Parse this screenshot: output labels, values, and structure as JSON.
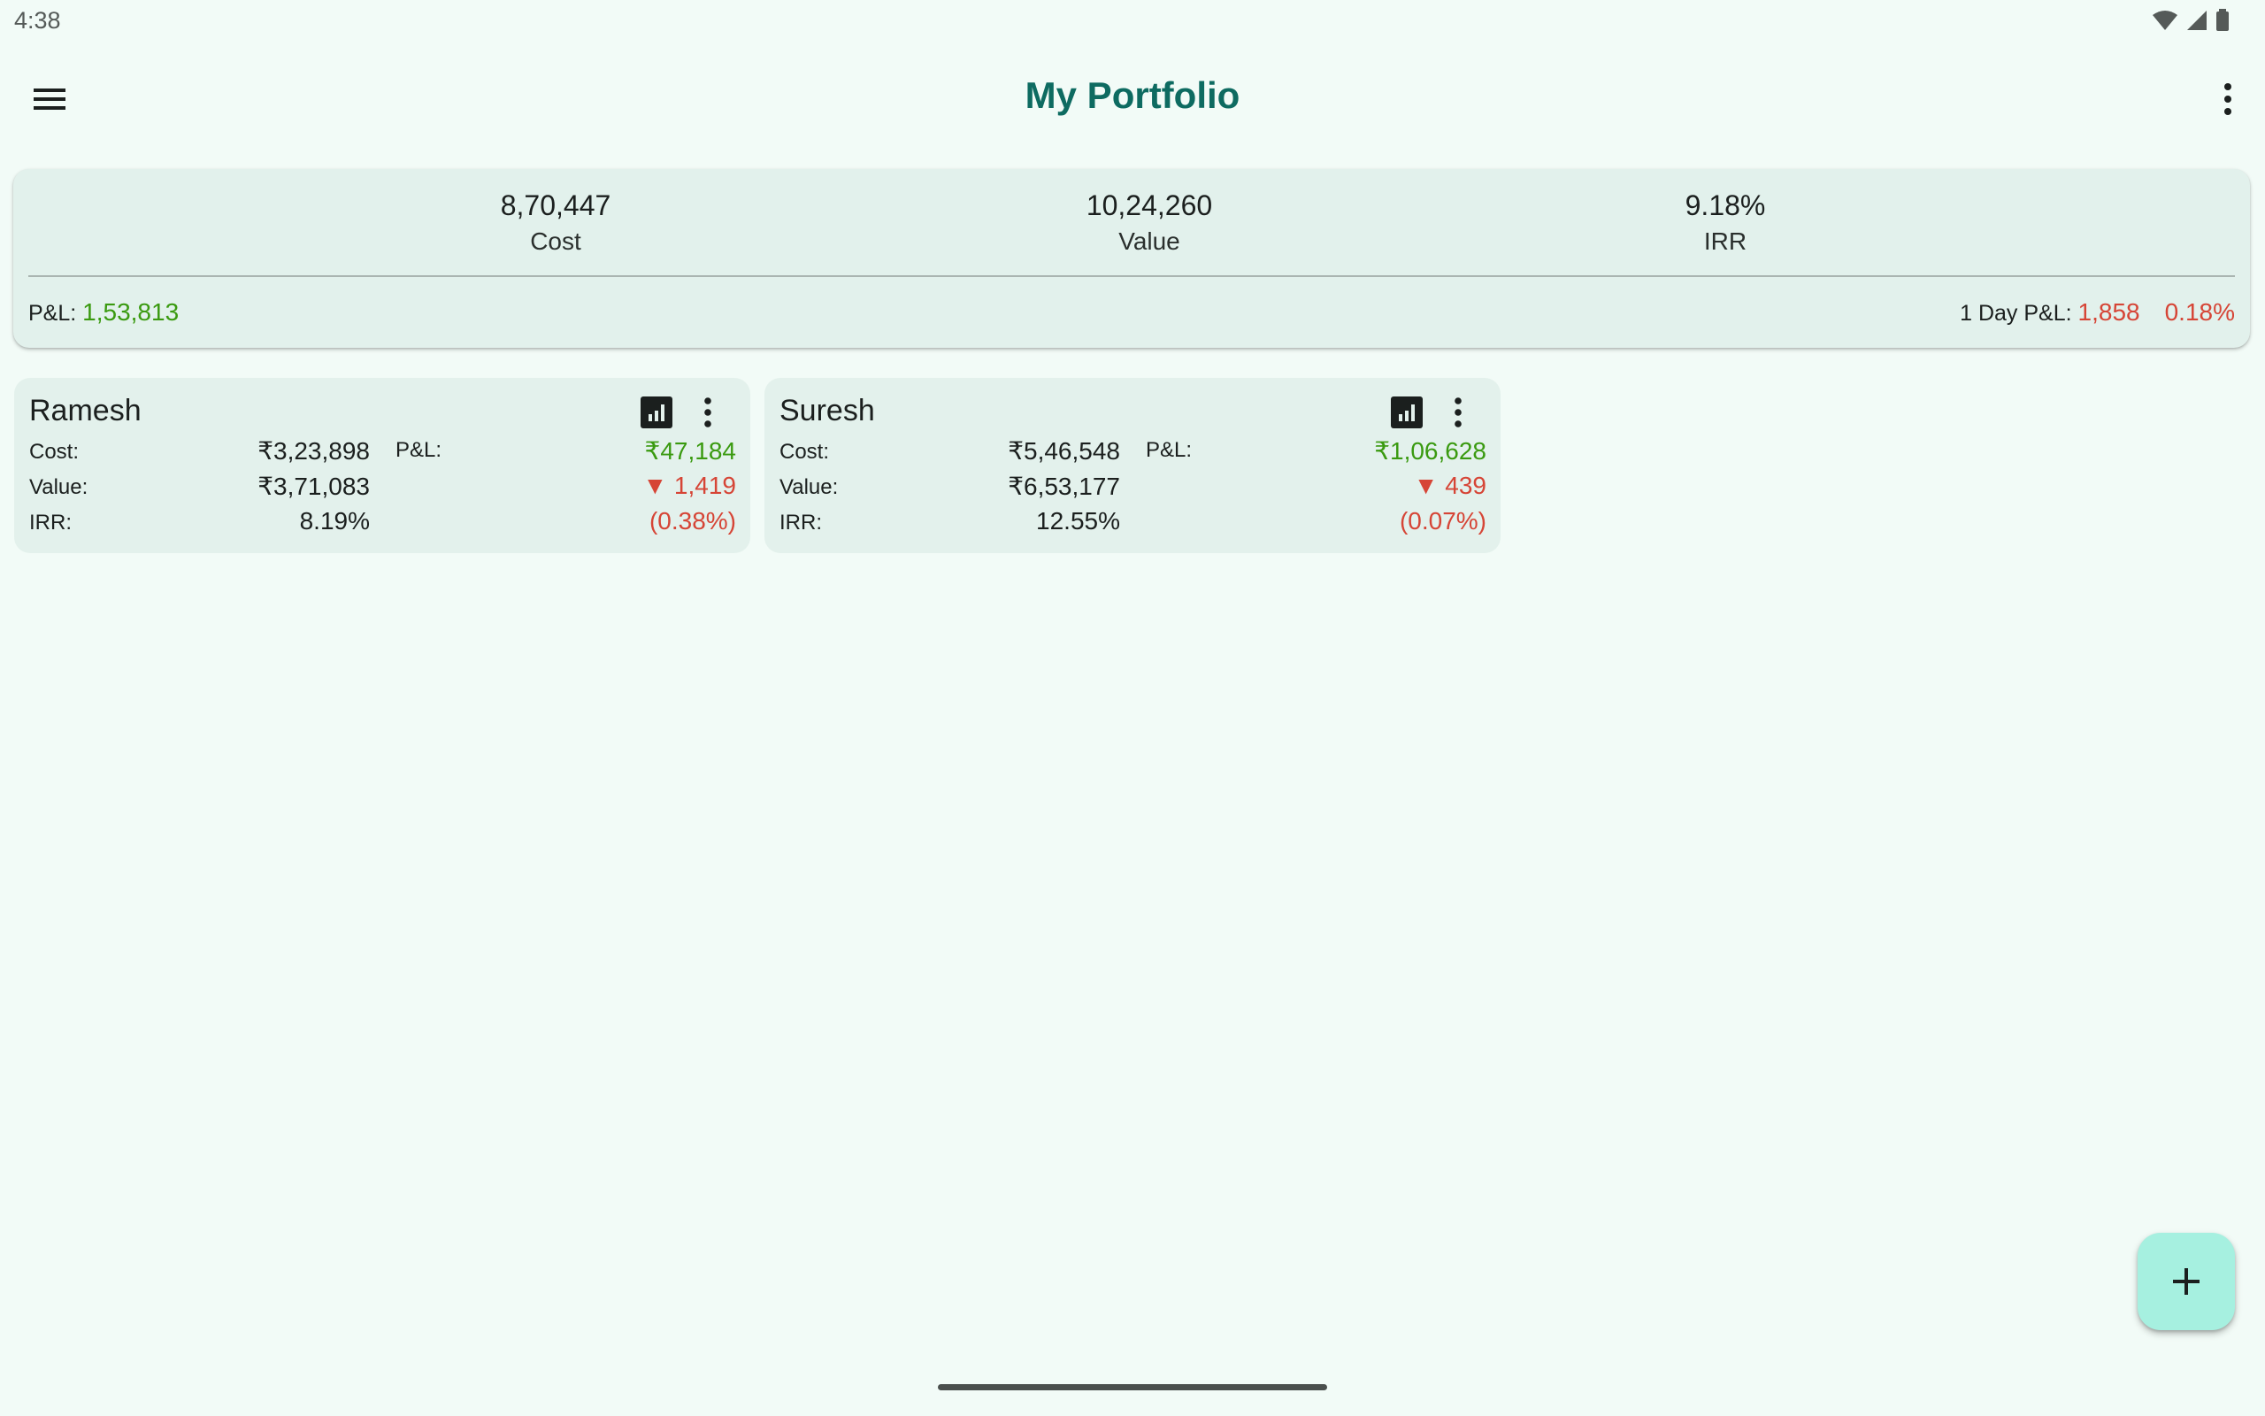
{
  "status_bar": {
    "time": "4:38",
    "icons": [
      "wifi-icon",
      "cellular-signal-icon",
      "battery-icon"
    ]
  },
  "app_bar": {
    "title": "My Portfolio",
    "menu_icon": "hamburger-menu-icon",
    "overflow_icon": "more-vertical-icon"
  },
  "summary": {
    "cost": "8,70,447",
    "cost_label": "Cost",
    "value": "10,24,260",
    "value_label": "Value",
    "irr": "9.18%",
    "irr_label": "IRR",
    "pl_label": "P&L:",
    "pl_value": "1,53,813",
    "day_pl_label": "1 Day P&L:",
    "day_pl_value": "1,858",
    "day_pl_percent": "0.18%"
  },
  "portfolios": [
    {
      "name": "Ramesh",
      "cost_label": "Cost:",
      "cost": "₹3,23,898",
      "value_label": "Value:",
      "value": "₹3,71,083",
      "irr_label": "IRR:",
      "irr": "8.19%",
      "pl_label": "P&L:",
      "pl": "₹47,184",
      "day_change": "▼ 1,419",
      "day_change_percent": "(0.38%)"
    },
    {
      "name": "Suresh",
      "cost_label": "Cost:",
      "cost": "₹5,46,548",
      "value_label": "Value:",
      "value": "₹6,53,177",
      "irr_label": "IRR:",
      "irr": "12.55%",
      "pl_label": "P&L:",
      "pl": "₹1,06,628",
      "day_change": "▼ 439",
      "day_change_percent": "(0.07%)"
    }
  ],
  "fab": {
    "icon": "plus-icon"
  },
  "colors": {
    "background": "#f2fbf7",
    "title": "#0e6b61",
    "card": "#e3f1ec",
    "positive": "#3a9a10",
    "negative": "#d64536",
    "fab": "#a6f0e0"
  }
}
